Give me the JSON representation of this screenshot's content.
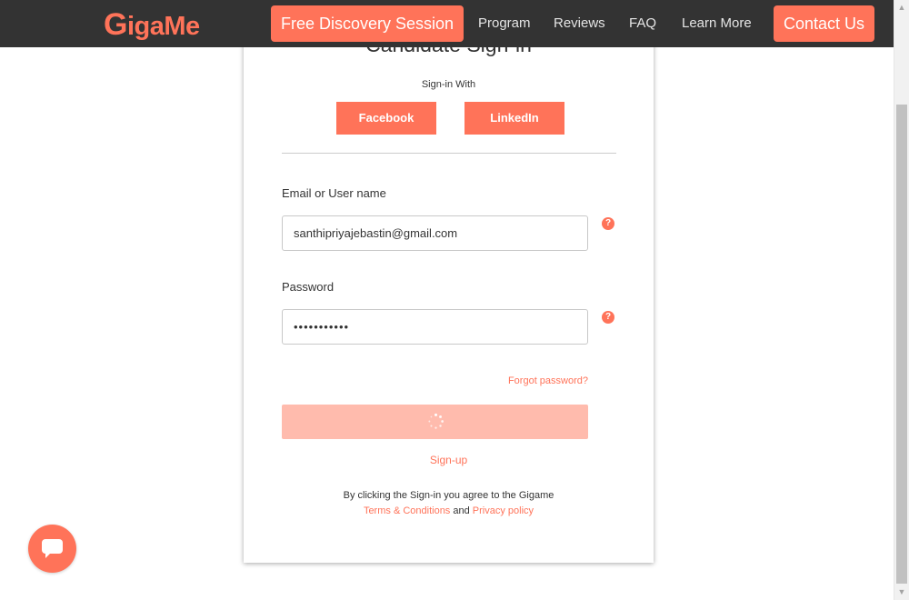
{
  "nav": {
    "logo_first": "G",
    "logo_rest": "igaMe",
    "discovery_label": "Free Discovery Session",
    "links": [
      "Program",
      "Reviews",
      "FAQ",
      "Learn More"
    ],
    "contact_label": "Contact Us"
  },
  "card": {
    "title": "Candidate Sign-in",
    "signin_with": "Sign-in With",
    "facebook_label": "Facebook",
    "linkedin_label": "LinkedIn",
    "email_label": "Email or User name",
    "email_value": "santhipriyajebastin@gmail.com",
    "password_label": "Password",
    "password_value": "•••••••••••",
    "help_glyph": "?",
    "forgot_label": "Forgot password?",
    "signup_label": "Sign-up",
    "terms_text": "By clicking the Sign-in you agree to the Gigame",
    "terms_link": "Terms & Conditions",
    "terms_and": "and",
    "privacy_link": "Privacy policy"
  },
  "colors": {
    "accent": "#ff7359",
    "nav_bg": "#333333",
    "submit_disabled": "#ffbbad"
  },
  "icons": {
    "help": "question-circle-icon",
    "spinner": "loading-spinner-icon",
    "chat": "chat-bubble-icon"
  }
}
